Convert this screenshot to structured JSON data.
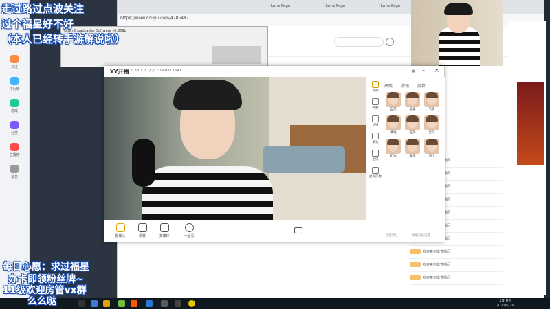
{
  "browser": {
    "url": "https://www.douyu.com/4785487",
    "tabs": [
      "Home Page",
      "Home Page",
      "Home Page"
    ]
  },
  "obs": {
    "title": "Open Broadcaster Software v0.659b"
  },
  "yy": {
    "logo": "YY开播",
    "version": "1.33.1.2 QQID: 940313647",
    "tabs": [
      "高级",
      "滤镜",
      "美妆"
    ],
    "side": [
      "美颜",
      "微整",
      "滤镜",
      "美妆",
      "贴纸",
      "虚拟形象"
    ],
    "faces": [
      "自然",
      "温柔",
      "气质",
      "清纯",
      "甜美",
      "元气",
      "奶油",
      "魔法",
      "清冷"
    ],
    "bottom": [
      "摄像头",
      "场景",
      "多媒体",
      "一起看"
    ],
    "reset": "恢复默认",
    "more": "效果开关设置"
  },
  "overlay": {
    "line1": "走过路过点波关注",
    "line2": "过个福星好不好",
    "line3": "（本人已经转手游解说啦）",
    "line4": "每日心愿：求过福星",
    "line5": "办卡即领粉丝牌~",
    "line6": "11级欢迎房管vx群",
    "line7": "么么哒"
  },
  "sidebar": [
    "关注",
    "排行榜",
    "游戏",
    "分类",
    "主播榜",
    "消息"
  ],
  "chat": {
    "rows": [
      "欢迎来到本直播间",
      "欢迎来到本直播间",
      "欢迎来到本直播间",
      "欢迎来到本直播间",
      "欢迎来到本直播间",
      "欢迎来到本直播间",
      "欢迎来到本直播间",
      "欢迎来到本直播间",
      "欢迎来到本直播间",
      "欢迎来到本直播间"
    ]
  },
  "taskbar": {
    "time": "18:04",
    "date": "2021/6/29"
  },
  "colors": {
    "accent": "#ff5a00",
    "overlay_stroke": "#1b4fb0",
    "taskbar": "#101820"
  }
}
